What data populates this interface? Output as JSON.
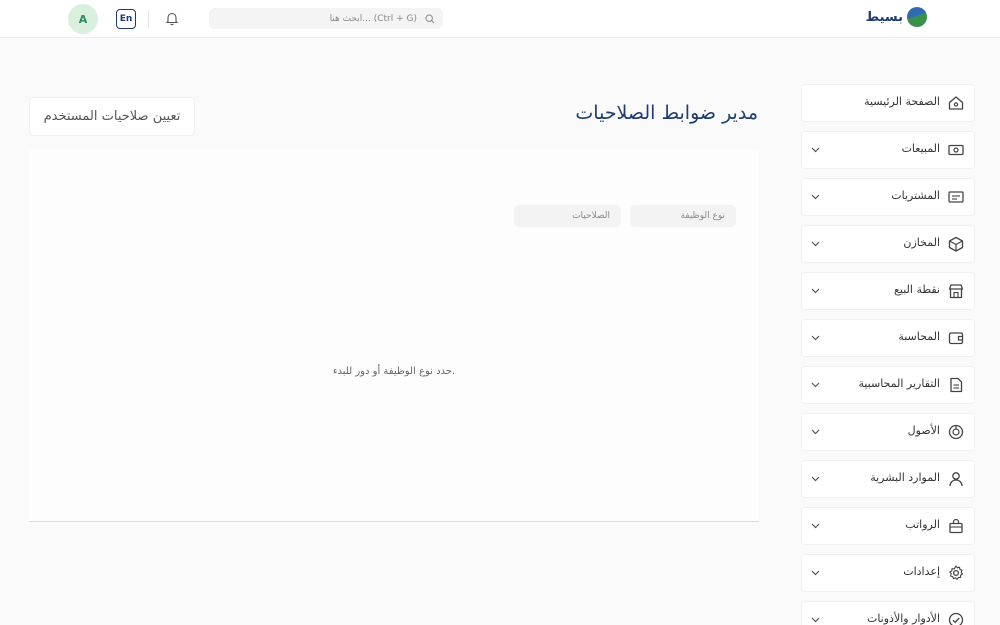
{
  "header": {
    "brand": "بسيط",
    "search_placeholder": "ابحث هنا... (Ctrl + G)",
    "lang": "En",
    "avatar": "A"
  },
  "main": {
    "title": "مدير ضوابط الصلاحيات",
    "assign_button": "تعيين صلاحيات المستخدم",
    "tabs": [
      "نوع الوظيفة",
      "الصلاحيات"
    ],
    "empty_message": "حدد نوع الوظيفة أو دور للبدء."
  },
  "sidebar": {
    "items": [
      {
        "label": "الصفحة الرئيسية",
        "icon": "home-icon",
        "expandable": false
      },
      {
        "label": "المبيعات",
        "icon": "cash-icon",
        "expandable": true
      },
      {
        "label": "المشتريات",
        "icon": "receipt-icon",
        "expandable": true
      },
      {
        "label": "المخازن",
        "icon": "box-icon",
        "expandable": true
      },
      {
        "label": "نقطة البيع",
        "icon": "store-icon",
        "expandable": true
      },
      {
        "label": "المحاسبة",
        "icon": "wallet-icon",
        "expandable": true
      },
      {
        "label": "التقارير المحاسبية",
        "icon": "document-icon",
        "expandable": true
      },
      {
        "label": "الأصول",
        "icon": "pie-icon",
        "expandable": true
      },
      {
        "label": "الموارد البشرية",
        "icon": "user-icon",
        "expandable": true
      },
      {
        "label": "الرواتب",
        "icon": "bag-icon",
        "expandable": true
      },
      {
        "label": "إعدادات",
        "icon": "gear-icon",
        "expandable": true
      },
      {
        "label": "الأدوار والأذونات",
        "icon": "check-circle-icon",
        "expandable": true
      }
    ]
  },
  "colors": {
    "primary": "#1f3c6e",
    "avatar_bg": "#d9f0de",
    "avatar_fg": "#2e8b57"
  }
}
